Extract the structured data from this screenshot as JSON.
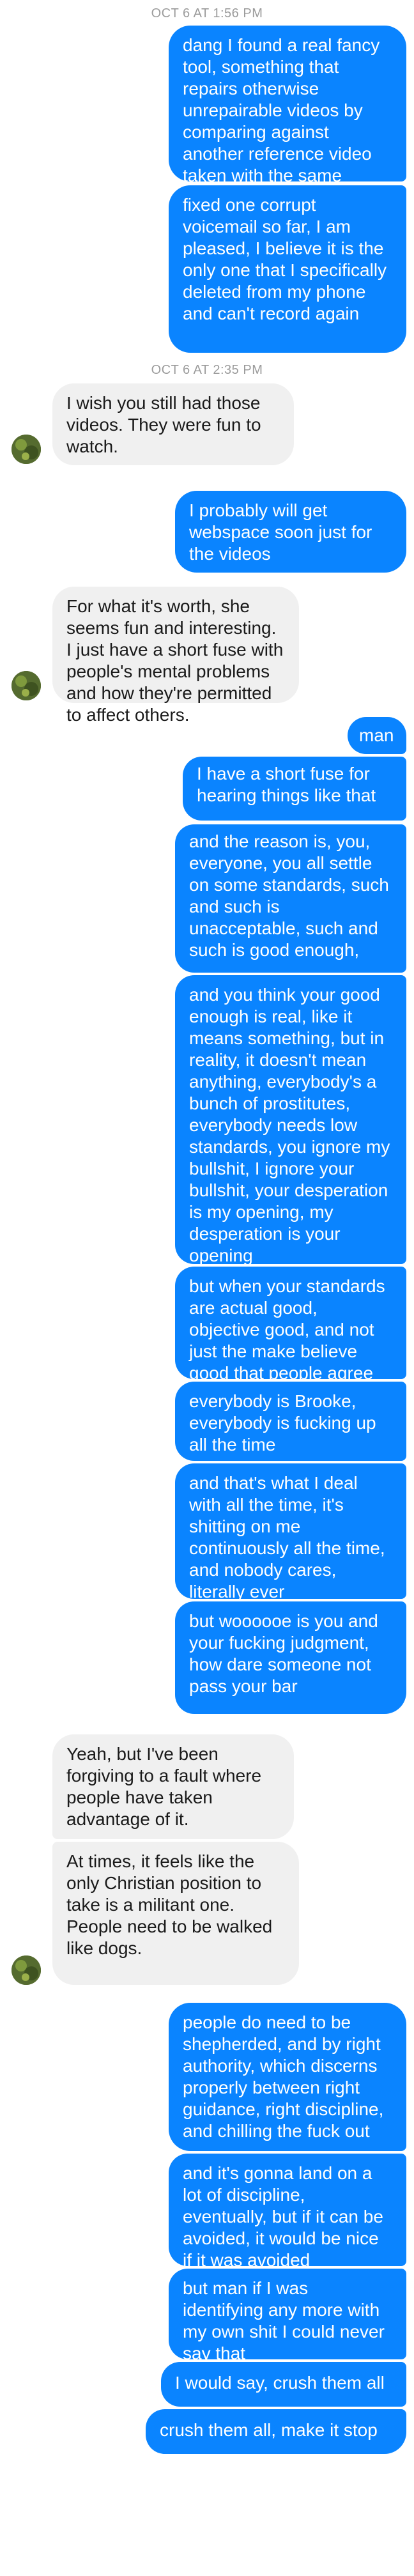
{
  "timestamps": [
    "OCT 6 AT 1:56 PM",
    "OCT 6 AT 2:35 PM"
  ],
  "colors": {
    "outgoing_bubble": "#0a84ff",
    "incoming_bubble": "#f0f0f0",
    "timestamp_text": "#9b9b9b"
  },
  "messages": [
    {
      "from": "me",
      "text": "dang I found a real fancy tool, something that repairs otherwise unrepairable videos by comparing against another reference video taken with the same camera"
    },
    {
      "from": "me",
      "text": "fixed one corrupt voicemail so far, I am pleased, I believe it is the only one that I specifically deleted from my phone and can't record again"
    },
    {
      "from": "them",
      "text": "I wish you still had those videos. They were fun to watch."
    },
    {
      "from": "me",
      "text": "I probably will get webspace soon just for the videos"
    },
    {
      "from": "them",
      "text": "For what it's worth, she seems fun and interesting. I just have a short fuse with people's mental problems and how they're permitted to affect others."
    },
    {
      "from": "me",
      "text": "man,"
    },
    {
      "from": "me",
      "text": "I have a short fuse for hearing things like that"
    },
    {
      "from": "me",
      "text": "and the reason is, you, everyone, you all settle on some standards, such and such is unacceptable, such and such is good enough,"
    },
    {
      "from": "me",
      "text": "and you think your good enough is real, like it means something, but in reality, it doesn't mean anything, everybody's a bunch of prostitutes, everybody needs low standards, you ignore my bullshit, I ignore your bullshit, your desperation is my opening, my desperation is your opening"
    },
    {
      "from": "me",
      "text": "but when your standards are actual good, objective good, and not just the make believe good that people agree to,"
    },
    {
      "from": "me",
      "text": "everybody is Brooke, everybody is fucking up all the time"
    },
    {
      "from": "me",
      "text": "and that's what I deal with all the time, it's shitting on me continuously all the time, and nobody cares, literally ever"
    },
    {
      "from": "me",
      "text": "but woooooe is you and your fucking judgment, how dare someone not pass your bar"
    },
    {
      "from": "them",
      "text": "Yeah, but I've been forgiving to a fault where people have taken advantage of it."
    },
    {
      "from": "them",
      "text": "At times, it feels like the only Christian position to take is a militant one. People need to be walked like dogs."
    },
    {
      "from": "me",
      "text": "people do need to be shepherded, and by right authority, which discerns properly between right guidance, right discipline, and chilling the fuck out"
    },
    {
      "from": "me",
      "text": "and it's gonna land on a lot of discipline, eventually, but if it can be avoided, it would be nice if it was avoided"
    },
    {
      "from": "me",
      "text": "but man if I was identifying any more with my own shit I could never say that"
    },
    {
      "from": "me",
      "text": "I would say, crush them all"
    },
    {
      "from": "me",
      "text": "crush them all, make it stop"
    }
  ]
}
